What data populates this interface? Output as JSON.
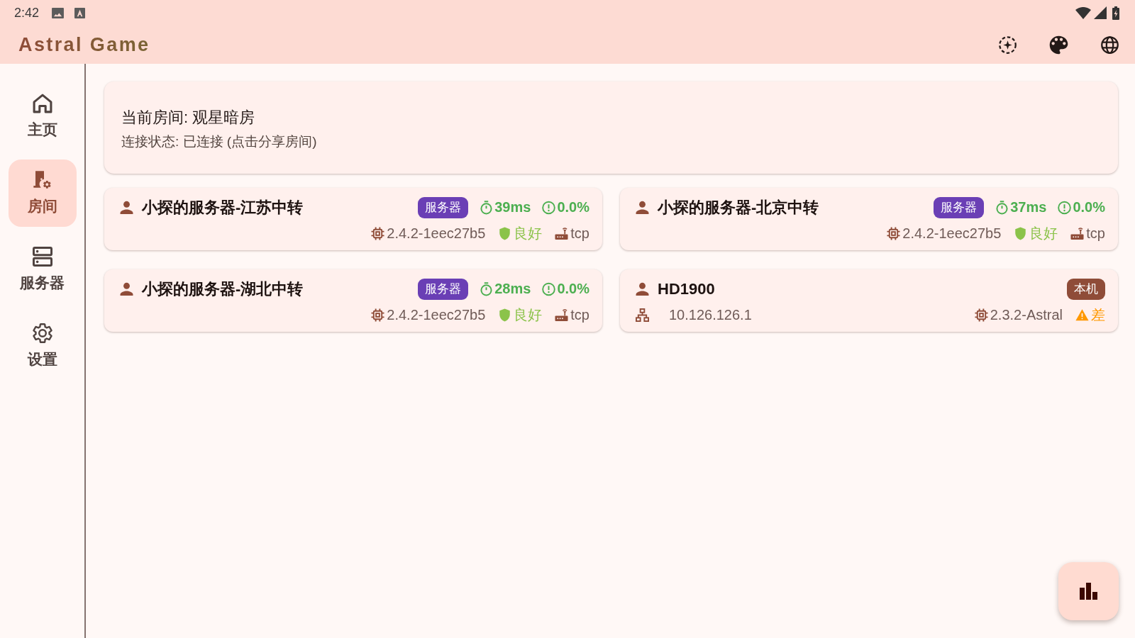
{
  "status_bar": {
    "time": "2:42"
  },
  "app_bar": {
    "title": "Astral Game"
  },
  "nav": [
    {
      "label": "主页",
      "selected": false
    },
    {
      "label": "房间",
      "selected": true
    },
    {
      "label": "服务器",
      "selected": false
    },
    {
      "label": "设置",
      "selected": false
    }
  ],
  "room": {
    "title": "当前房间: 观星暗房",
    "status": "连接状态: 已连接 (点击分享房间)"
  },
  "peers": [
    {
      "kind": "server",
      "name": "小探的服务器-江苏中转",
      "badge": {
        "label": "服务器",
        "color": "#6a3fb5"
      },
      "latency": "39ms",
      "loss": "0.0%",
      "version": "2.4.2-1eec27b5",
      "quality": {
        "kind": "good",
        "label": "良好"
      },
      "protocol": "tcp"
    },
    {
      "kind": "server",
      "name": "小探的服务器-北京中转",
      "badge": {
        "label": "服务器",
        "color": "#6a3fb5"
      },
      "latency": "37ms",
      "loss": "0.0%",
      "version": "2.4.2-1eec27b5",
      "quality": {
        "kind": "good",
        "label": "良好"
      },
      "protocol": "tcp"
    },
    {
      "kind": "server",
      "name": "小探的服务器-湖北中转",
      "badge": {
        "label": "服务器",
        "color": "#6a3fb5"
      },
      "latency": "28ms",
      "loss": "0.0%",
      "version": "2.4.2-1eec27b5",
      "quality": {
        "kind": "good",
        "label": "良好"
      },
      "protocol": "tcp"
    },
    {
      "kind": "local",
      "name": "HD1900",
      "badge": {
        "label": "本机",
        "color": "#8f4c38"
      },
      "ip": "10.126.126.1",
      "version": "2.3.2-Astral",
      "quality": {
        "kind": "poor",
        "label": "差"
      }
    }
  ]
}
